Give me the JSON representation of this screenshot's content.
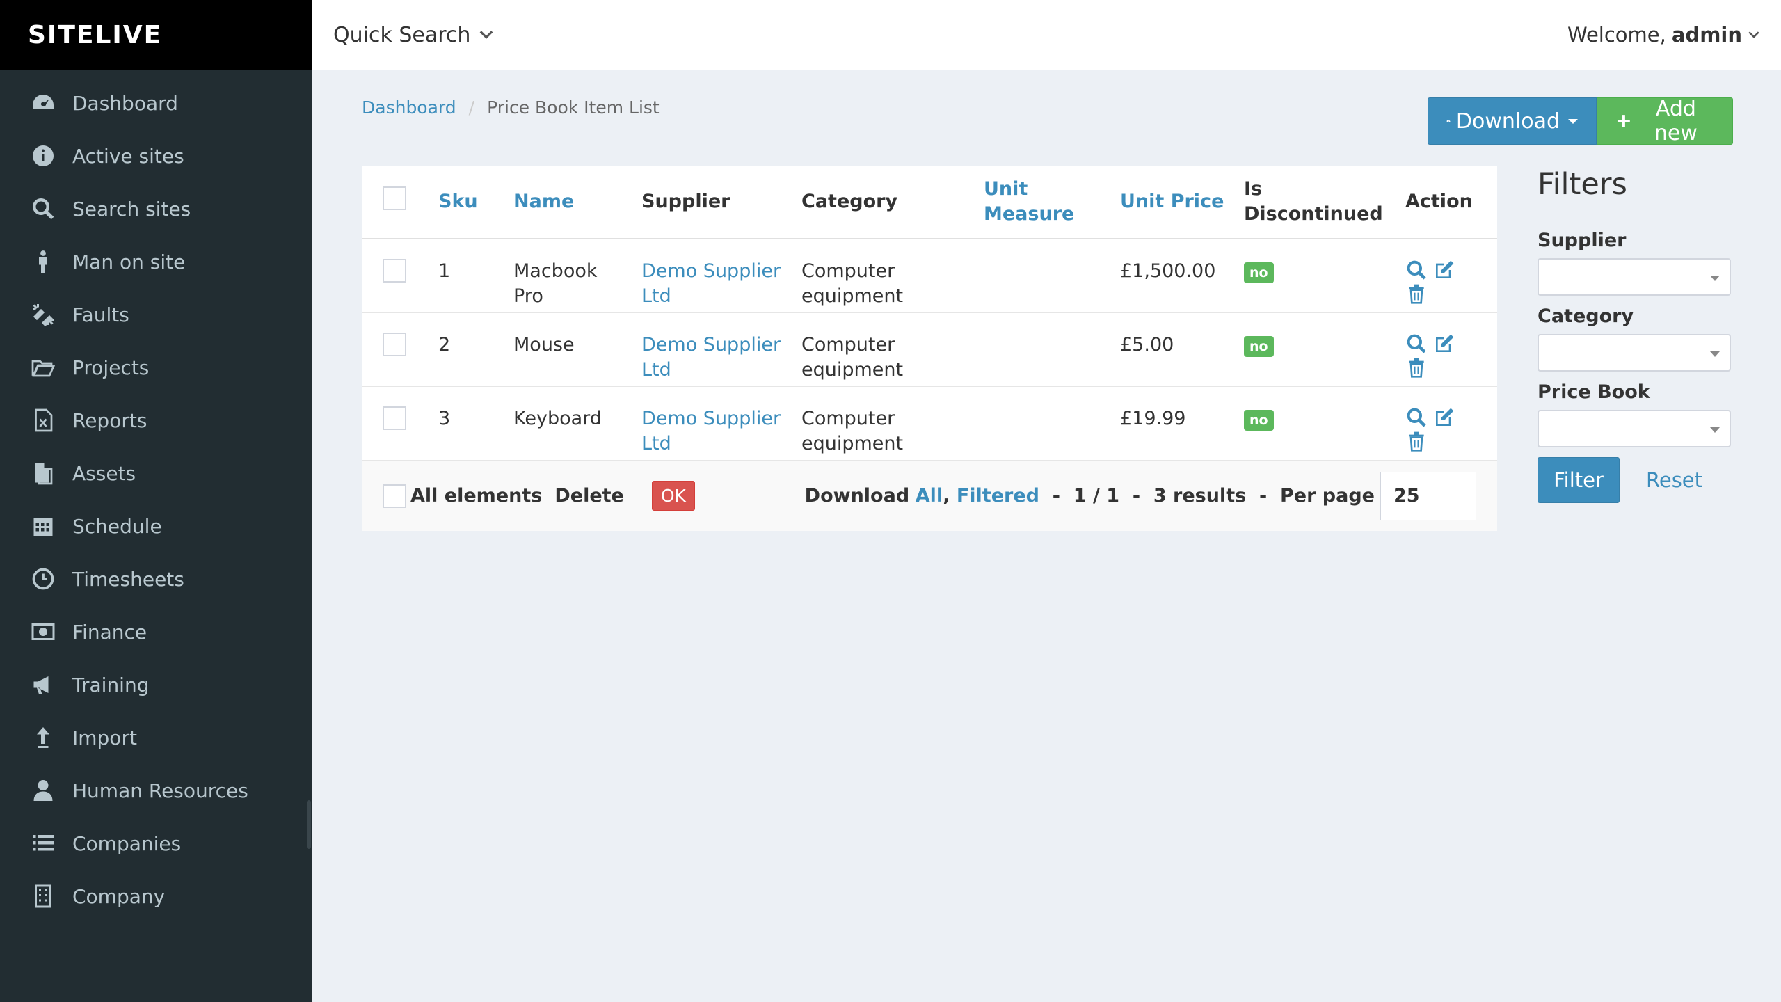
{
  "app": {
    "logo_text": "SITELIVE"
  },
  "sidebar": {
    "items": [
      {
        "label": "Dashboard",
        "icon": "dashboard-icon"
      },
      {
        "label": "Active sites",
        "icon": "info-icon"
      },
      {
        "label": "Search sites",
        "icon": "search-icon"
      },
      {
        "label": "Man on site",
        "icon": "person-icon"
      },
      {
        "label": "Faults",
        "icon": "broken-link-icon"
      },
      {
        "label": "Projects",
        "icon": "folder-icon"
      },
      {
        "label": "Reports",
        "icon": "excel-file-icon"
      },
      {
        "label": "Assets",
        "icon": "files-icon"
      },
      {
        "label": "Schedule",
        "icon": "calendar-icon"
      },
      {
        "label": "Timesheets",
        "icon": "clock-icon"
      },
      {
        "label": "Finance",
        "icon": "money-icon"
      },
      {
        "label": "Training",
        "icon": "bullhorn-icon"
      },
      {
        "label": "Import",
        "icon": "upload-arrow-icon"
      },
      {
        "label": "Human Resources",
        "icon": "user-icon"
      },
      {
        "label": "Companies",
        "icon": "list-icon"
      },
      {
        "label": "Company",
        "icon": "building-icon"
      }
    ]
  },
  "topbar": {
    "quick_search": "Quick Search",
    "welcome_prefix": "Welcome,",
    "username": "admin"
  },
  "breadcrumb": {
    "root": "Dashboard",
    "separator": "/",
    "current": "Price Book Item List"
  },
  "toolbar": {
    "download_label": "Download",
    "add_new_label": "Add new"
  },
  "table": {
    "headers": {
      "sku": "Sku",
      "name": "Name",
      "supplier": "Supplier",
      "category": "Category",
      "unit_measure": "Unit Measure",
      "unit_price": "Unit Price",
      "is_discontinued": "Is Discontinued",
      "action": "Action"
    },
    "rows": [
      {
        "sku": "1",
        "name": "Macbook Pro",
        "supplier": "Demo Supplier Ltd",
        "category": "Computer equipment",
        "unit_measure": "",
        "unit_price": "£1,500.00",
        "is_discontinued": "no"
      },
      {
        "sku": "2",
        "name": "Mouse",
        "supplier": "Demo Supplier Ltd",
        "category": "Computer equipment",
        "unit_measure": "",
        "unit_price": "£5.00",
        "is_discontinued": "no"
      },
      {
        "sku": "3",
        "name": "Keyboard",
        "supplier": "Demo Supplier Ltd",
        "category": "Computer equipment",
        "unit_measure": "",
        "unit_price": "£19.99",
        "is_discontinued": "no"
      }
    ]
  },
  "footer": {
    "all_elements": "All elements",
    "delete_action": "Delete",
    "ok": "OK",
    "download_label": "Download",
    "download_all": "All",
    "download_filtered": "Filtered",
    "pages": "1 / 1",
    "results": "3 results",
    "per_page_label": "Per page",
    "per_page_value": "25"
  },
  "filters": {
    "title": "Filters",
    "supplier_label": "Supplier",
    "category_label": "Category",
    "price_book_label": "Price Book",
    "filter_button": "Filter",
    "reset_link": "Reset"
  },
  "colors": {
    "sidebar_bg": "#222d32",
    "accent": "#3c8dbc",
    "success": "#5cb85c",
    "danger": "#d9534f"
  }
}
